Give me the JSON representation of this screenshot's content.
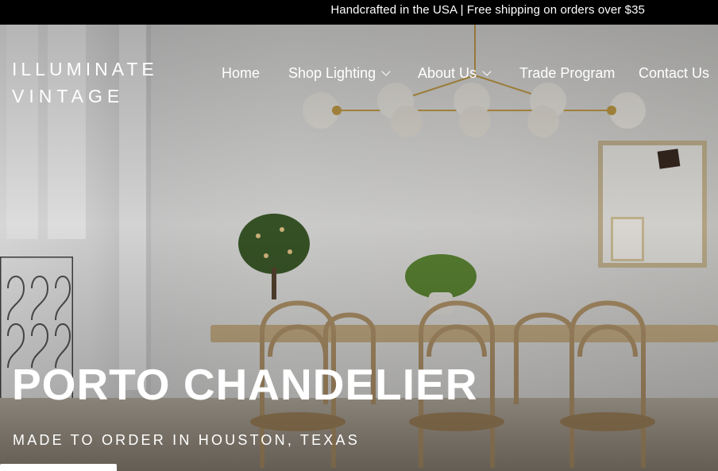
{
  "announcement": {
    "text": "Handcrafted in the USA | Free shipping on orders over $35"
  },
  "logo": {
    "line1": "ILLUMINATE",
    "line2": "VINTAGE"
  },
  "nav": {
    "items": [
      {
        "label": "Home",
        "has_dropdown": false
      },
      {
        "label": "Shop Lighting",
        "has_dropdown": true
      },
      {
        "label": "About Us",
        "has_dropdown": true
      },
      {
        "label": "Trade Program",
        "has_dropdown": false
      },
      {
        "label": "Contact Us",
        "has_dropdown": false
      }
    ]
  },
  "hero": {
    "title": "PORTO CHANDELIER",
    "subtitle": "MADE TO ORDER IN HOUSTON, TEXAS",
    "image_subject": "dining-room-chandelier-photo"
  },
  "icons": {
    "dropdown": "chevron-down-icon"
  },
  "colors": {
    "topbar_bg": "#000000",
    "text_light": "#ffffff",
    "brass": "#c9a24a",
    "globe": "#f2efe8"
  }
}
